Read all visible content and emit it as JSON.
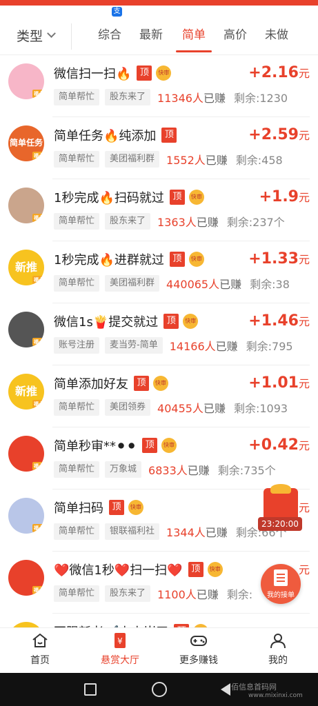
{
  "filter": {
    "type_label": "类型",
    "tabs": [
      "综合",
      "最新",
      "简单",
      "高价",
      "未做"
    ],
    "active_tab": "简单"
  },
  "badges": {
    "ding": "顶",
    "kuai": "快审",
    "avatar_badge": "福卡"
  },
  "items": [
    {
      "title": "微信扫一扫🔥",
      "kuai": true,
      "price": "+2.16",
      "unit": "元",
      "tag1": "简单帮忙",
      "tag2": "股东来了",
      "earned": "11346人",
      "earned_suffix": "已赚",
      "remain": "剩余:1230",
      "avatar_text": "",
      "avatar_color": "#f7b6c8"
    },
    {
      "title": "简单任务🔥纯添加",
      "kuai": false,
      "price": "+2.59",
      "unit": "元",
      "tag1": "简单帮忙",
      "tag2": "美团福利群",
      "earned": "1552人",
      "earned_suffix": "已赚",
      "remain": "剩余:458",
      "avatar_text": "简单任务",
      "avatar_color": "#e8662b"
    },
    {
      "title": "1秒完成🔥扫码就过",
      "kuai": true,
      "price": "+1.9",
      "unit": "元",
      "tag1": "简单帮忙",
      "tag2": "股东来了",
      "earned": "1363人",
      "earned_suffix": "已赚",
      "remain": "剩余:237个",
      "avatar_text": "",
      "avatar_color": "#caa58c"
    },
    {
      "title": "1秒完成🔥进群就过",
      "kuai": true,
      "price": "+1.33",
      "unit": "元",
      "tag1": "简单帮忙",
      "tag2": "美团福利群",
      "earned": "440065人",
      "earned_suffix": "已赚",
      "remain": "剩余:38",
      "avatar_text": "新推",
      "avatar_color": "#f7c31f"
    },
    {
      "title": "微信1s🍟提交就过",
      "kuai": true,
      "price": "+1.46",
      "unit": "元",
      "tag1": "账号注册",
      "tag2": "麦当劳-简单",
      "earned": "14166人",
      "earned_suffix": "已赚",
      "remain": "剩余:795",
      "avatar_text": "",
      "avatar_color": "#555555"
    },
    {
      "title": "简单添加好友",
      "kuai": true,
      "price": "+1.01",
      "unit": "元",
      "tag1": "简单帮忙",
      "tag2": "美团领券",
      "earned": "40455人",
      "earned_suffix": "已赚",
      "remain": "剩余:1093",
      "avatar_text": "新推",
      "avatar_color": "#f7c31f"
    },
    {
      "title": "简单秒审**⚫⚫",
      "kuai": true,
      "price": "+0.42",
      "unit": "元",
      "tag1": "简单帮忙",
      "tag2": "万象城",
      "earned": "6833人",
      "earned_suffix": "已赚",
      "remain": "剩余:735个",
      "avatar_text": "",
      "avatar_color": "#e8412b"
    },
    {
      "title": "简单扫码",
      "kuai": true,
      "price": "+",
      "unit": "元",
      "tag1": "简单帮忙",
      "tag2": "银联福利社",
      "earned": "1344人",
      "earned_suffix": "已赚",
      "remain": "剩余:66个",
      "avatar_text": "",
      "avatar_color": "#b9c6e8"
    },
    {
      "title": "❤️微信1秒❤️扫一扫❤️",
      "kuai": true,
      "price": "",
      "unit": "元",
      "tag1": "简单帮忙",
      "tag2": "股东来了",
      "earned": "1100人",
      "earned_suffix": "已赚",
      "remain": "剩余:",
      "avatar_text": "",
      "avatar_color": "#e8412b"
    },
    {
      "title": "不限新老✔️上上岸了",
      "kuai": true,
      "price": "",
      "unit": "",
      "tag1": "",
      "tag2": "",
      "earned": "",
      "earned_suffix": "",
      "remain": "",
      "avatar_text": "",
      "avatar_color": "#f7c31f"
    }
  ],
  "float_timer": "23:20:00",
  "float_order_label": "我的接单",
  "nav": [
    {
      "label": "首页",
      "icon": "home-icon"
    },
    {
      "label": "悬赏大厅",
      "icon": "reward-icon",
      "active": true
    },
    {
      "label": "更多赚钱",
      "icon": "gamepad-icon"
    },
    {
      "label": "我的",
      "icon": "profile-icon"
    }
  ],
  "watermark": {
    "line1": "佰信息首码网",
    "line2": "www.mixinxi.com"
  },
  "colors": {
    "accent": "#e8412b"
  }
}
